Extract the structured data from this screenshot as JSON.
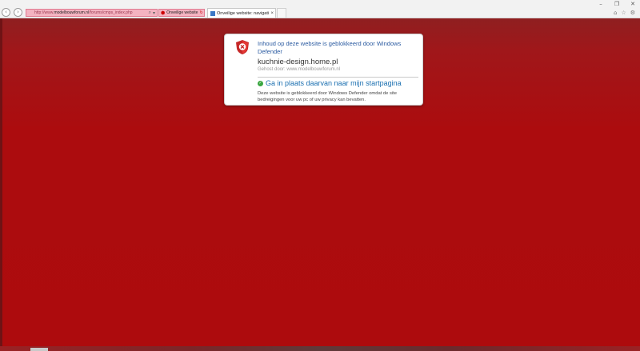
{
  "browser": {
    "address_url_prefix": "http://www.",
    "address_url_domain": "modelbouwforum.nl",
    "address_url_suffix": "/forums/cmps_index.php",
    "search_icon": "search-icon",
    "refresh_icon": "refresh-icon",
    "unsafe_badge": "Onveilige website",
    "tab_label": "Onveilige website: navigati...",
    "window_controls": [
      "–",
      "❐",
      "✕"
    ],
    "right_icons": [
      "home-icon",
      "star-icon",
      "gear-icon"
    ]
  },
  "dialog": {
    "title": "Inhoud op deze website is geblokkeerd door Windows Defender",
    "domain": "kuchnie-design.home.pl",
    "hosted_by": "Gehost door: www.modelbouwforum.nl",
    "action": "Ga in plaats daarvan naar mijn startpagina",
    "description": "Deze website is geblokkeerd door Windows Defender omdat de site bedreigingen voor uw pc of uw privacy kan bevatten."
  },
  "colors": {
    "accent_link": "#1a6fb0",
    "title_blue": "#2a5aa0",
    "unsafe_red": "#ad0b0d",
    "address_pink": "#f4b3c1"
  }
}
